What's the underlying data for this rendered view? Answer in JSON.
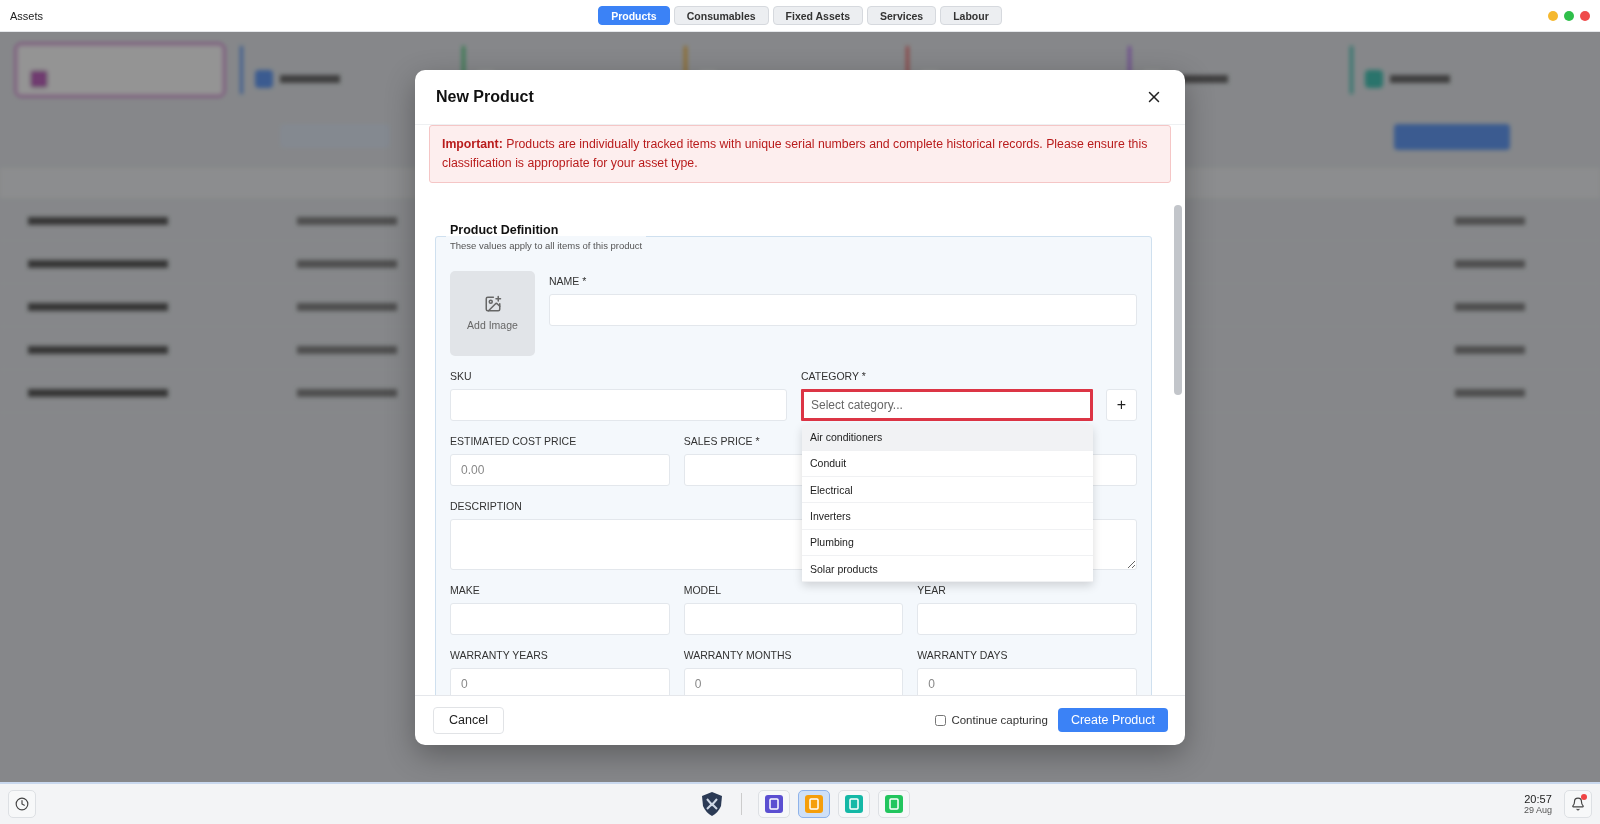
{
  "window": {
    "title": "Assets",
    "controls": [
      {
        "color": "#f5b82e"
      },
      {
        "color": "#2fbf4a"
      },
      {
        "color": "#ef4b4b"
      }
    ]
  },
  "tabs": [
    {
      "label": "Products",
      "selected": true
    },
    {
      "label": "Consumables",
      "selected": false
    },
    {
      "label": "Fixed Assets",
      "selected": false
    },
    {
      "label": "Services",
      "selected": false
    },
    {
      "label": "Labour",
      "selected": false
    }
  ],
  "dialog": {
    "title": "New Product",
    "alert": "**Important:** Products are individually tracked items with unique serial numbers and complete historical records. Please ensure this classification is appropriate for your asset type.",
    "section": {
      "title": "Product Definition",
      "subtitle": "These values apply to all items of this product"
    },
    "image": {
      "label": "Add Image"
    },
    "name": {
      "label": "NAME *"
    },
    "sku": {
      "label": "SKU"
    },
    "category": {
      "label": "CATEGORY *",
      "placeholder": "Select category...",
      "add": "+",
      "options": [
        {
          "label": "Air conditioners",
          "selected": true
        },
        {
          "label": "Conduit",
          "selected": false
        },
        {
          "label": "Electrical",
          "selected": false
        },
        {
          "label": "Inverters",
          "selected": false
        },
        {
          "label": "Plumbing",
          "selected": false
        },
        {
          "label": "Solar products",
          "selected": false
        }
      ]
    },
    "rows": [
      [
        {
          "kind": "input",
          "label": "ESTIMATED COST PRICE",
          "placeholder": "0.00"
        },
        {
          "kind": "input",
          "label": "SALES PRICE *"
        },
        {
          "kind": "input"
        }
      ],
      [
        {
          "kind": "textarea",
          "label": "DESCRIPTION"
        }
      ],
      [
        {
          "kind": "input",
          "label": "MAKE"
        },
        {
          "kind": "input",
          "label": "MODEL"
        },
        {
          "kind": "input",
          "label": "YEAR"
        }
      ],
      [
        {
          "kind": "input",
          "label": "WARRANTY YEARS",
          "placeholder": "0"
        },
        {
          "kind": "input",
          "label": "WARRANTY MONTHS",
          "placeholder": "0"
        },
        {
          "kind": "input",
          "label": "WARRANTY DAYS",
          "placeholder": "0"
        }
      ]
    ],
    "cancel": "Cancel",
    "continue": {
      "label": "Continue capturing",
      "checked": false
    },
    "submit": "Create Product"
  },
  "taskbar": {
    "apps": [
      {
        "color": "#5b4fd1",
        "selected": false
      },
      {
        "color": "#f59e0b",
        "selected": true
      },
      {
        "color": "#14b8a6",
        "selected": false
      },
      {
        "color": "#22c55e",
        "selected": false
      }
    ],
    "time": "20:57",
    "date": "29 Aug",
    "notification": true
  }
}
